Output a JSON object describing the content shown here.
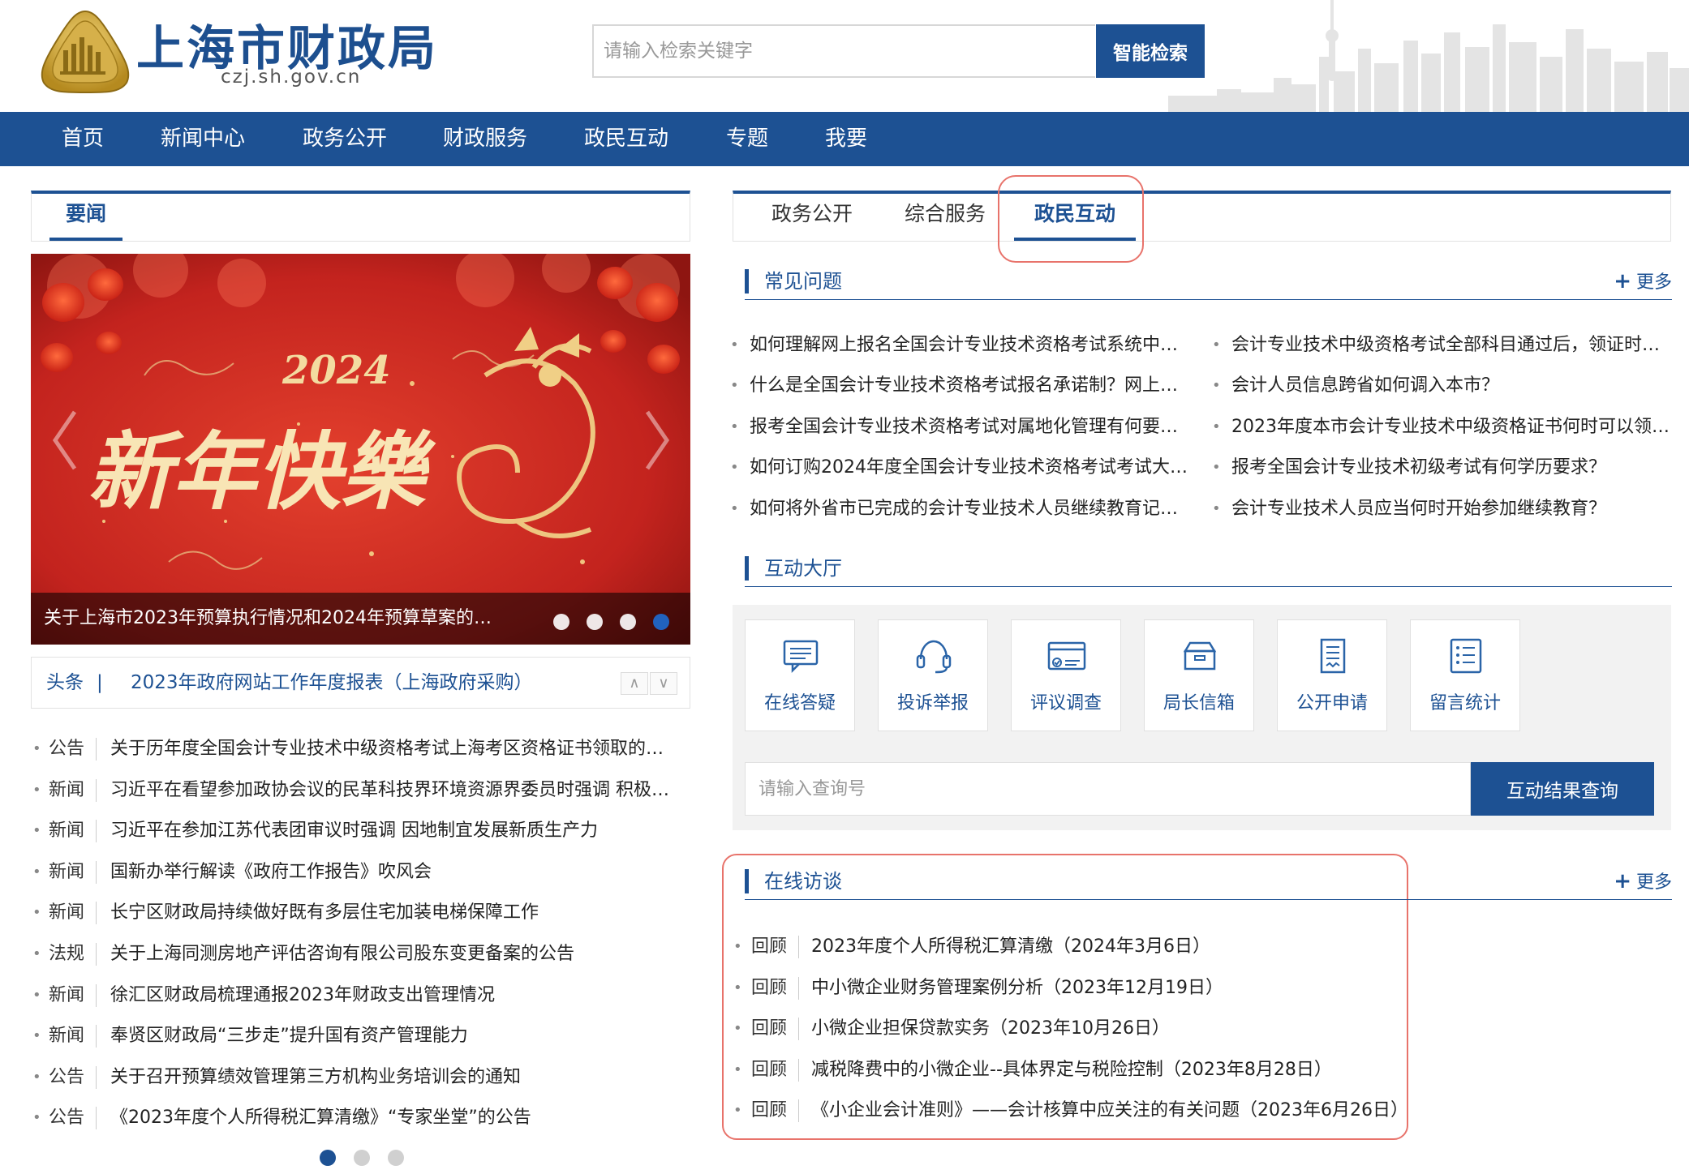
{
  "header": {
    "site_title": "上海市财政局",
    "site_domain": "czj.sh.gov.cn",
    "search_placeholder": "请输入检索关键字",
    "search_button": "智能检索"
  },
  "nav": {
    "items": [
      "首页",
      "新闻中心",
      "政务公开",
      "财政服务",
      "政民互动",
      "专题",
      "我要"
    ]
  },
  "left": {
    "news_tab": "要闻",
    "carousel": {
      "caption": "关于上海市2023年预算执行情况和2024年预算草案的…",
      "banner_year": "2024",
      "banner_text": "新年快樂",
      "slide_count": 4,
      "active_slide": 4
    },
    "headline": {
      "tag": "头条",
      "separator": "|",
      "title": "2023年政府网站工作年度报表（上海政府采购）",
      "up_label": "∧",
      "down_label": "∨"
    },
    "news": [
      {
        "cat": "公告",
        "title": "关于历年度全国会计专业技术中级资格考试上海考区资格证书领取的…"
      },
      {
        "cat": "新闻",
        "title": "习近平在看望参加政协会议的民革科技界环境资源界委员时强调 积极…"
      },
      {
        "cat": "新闻",
        "title": "习近平在参加江苏代表团审议时强调 因地制宜发展新质生产力"
      },
      {
        "cat": "新闻",
        "title": "国新办举行解读《政府工作报告》吹风会"
      },
      {
        "cat": "新闻",
        "title": "长宁区财政局持续做好既有多层住宅加装电梯保障工作"
      },
      {
        "cat": "法规",
        "title": "关于上海同测房地产评估咨询有限公司股东变更备案的公告"
      },
      {
        "cat": "新闻",
        "title": "徐汇区财政局梳理通报2023年财政支出管理情况"
      },
      {
        "cat": "新闻",
        "title": "奉贤区财政局“三步走”提升国有资产管理能力"
      },
      {
        "cat": "公告",
        "title": "关于召开预算绩效管理第三方机构业务培训会的通知"
      },
      {
        "cat": "公告",
        "title": "《2023年度个人所得税汇算清缴》“专家坐堂”的公告"
      }
    ],
    "page_count": 3,
    "active_page": 1
  },
  "right": {
    "tabs": [
      "政务公开",
      "综合服务",
      "政民互动"
    ],
    "active_tab": "政民互动",
    "faq": {
      "title": "常见问题",
      "more": "更多",
      "left_items": [
        "如何理解网上报名全国会计专业技术资格考试系统中…",
        "什么是全国会计专业技术资格考试报名承诺制？网上…",
        "报考全国会计专业技术资格考试对属地化管理有何要…",
        "如何订购2024年度全国会计专业技术资格考试考试大…",
        "如何将外省市已完成的会计专业技术人员继续教育记…"
      ],
      "right_items": [
        "会计专业技术中级资格考试全部科目通过后，领证时…",
        "会计人员信息跨省如何调入本市？",
        "2023年度本市会计专业技术中级资格证书何时可以领…",
        "报考全国会计专业技术初级考试有何学历要求？",
        "会计专业技术人员应当何时开始参加继续教育？"
      ]
    },
    "hall": {
      "title": "互动大厅",
      "cards": [
        {
          "label": "在线答疑",
          "icon": "chat-icon"
        },
        {
          "label": "投诉举报",
          "icon": "headset-icon"
        },
        {
          "label": "评议调查",
          "icon": "card-check-icon"
        },
        {
          "label": "局长信箱",
          "icon": "mailbox-icon"
        },
        {
          "label": "公开申请",
          "icon": "document-icon"
        },
        {
          "label": "留言统计",
          "icon": "list-icon"
        }
      ],
      "query_placeholder": "请输入查询号",
      "query_button": "互动结果查询"
    },
    "interview": {
      "title": "在线访谈",
      "more": "更多",
      "items": [
        {
          "cat": "回顾",
          "title": "2023年度个人所得税汇算清缴（2024年3月6日）"
        },
        {
          "cat": "回顾",
          "title": "中小微企业财务管理案例分析（2023年12月19日）"
        },
        {
          "cat": "回顾",
          "title": "小微企业担保贷款实务（2023年10月26日）"
        },
        {
          "cat": "回顾",
          "title": "减税降费中的小微企业--具体界定与税险控制（2023年8月28日）"
        },
        {
          "cat": "回顾",
          "title": "《小企业会计准则》——会计核算中应关注的有关问题（2023年6月26日）"
        }
      ]
    }
  },
  "colors": {
    "brand_blue": "#1d5193",
    "highlight_red": "#e8736b",
    "banner_red": "#c3231e",
    "gold": "#e9c98a"
  }
}
